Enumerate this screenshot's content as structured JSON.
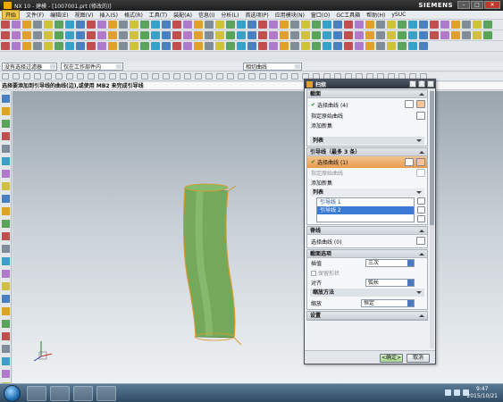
{
  "window": {
    "title": "NX 10 - 建模 - [1007001.prt (修改的)]",
    "brand": "SIEMENS"
  },
  "menu": {
    "start": "开始",
    "items": [
      "文件(F)",
      "编辑(E)",
      "视图(V)",
      "插入(S)",
      "格式(R)",
      "工具(T)",
      "装配(A)",
      "信息(I)",
      "分析(L)",
      "首选项(P)",
      "应用模块(N)",
      "窗口(O)",
      "GC工具箱",
      "帮助(H)",
      "ySUC"
    ]
  },
  "filter": {
    "type_filter": "没有选择过滤器",
    "scope": "仅在工作部件内",
    "curve_rule": "相切曲线"
  },
  "cue": "选择要添加到引导线的曲线(边),或使用 MB2 来完成引导线",
  "dialog": {
    "title": "扫掠",
    "sections": {
      "header": "截面",
      "select_curve": "选择曲线 (4)",
      "specify_origin": "指定原始曲线",
      "add_new_set": "添加新集",
      "list": "列表",
      "guides_header": "引导线（最多 3 条）",
      "guide_select": "选择曲线 (1)",
      "guide_origin": "指定原始曲线",
      "guide_add_set": "添加新集",
      "guide_list_title": "列表",
      "guide_list_items": [
        "引导线 1",
        "引导线 2"
      ],
      "spine_header": "脊线",
      "spine_select": "选择曲线 (0)",
      "options_header": "截面选项",
      "interp_label": "插值",
      "interp_value": "三次",
      "keep_shape": "保留形状",
      "align_label": "对齐",
      "align_value": "弧长",
      "orient_title": "缩放方法",
      "scale_label": "缩放",
      "scale_value": "恒定",
      "settings_header": "设置"
    },
    "ok": "<确定>",
    "cancel": "取消"
  },
  "taskbar": {
    "time": "9:47",
    "date": "2015/10/21"
  },
  "colors": {
    "body": "#74a85a",
    "curve": "#d99a2c",
    "accent": "#3b7bd4"
  }
}
